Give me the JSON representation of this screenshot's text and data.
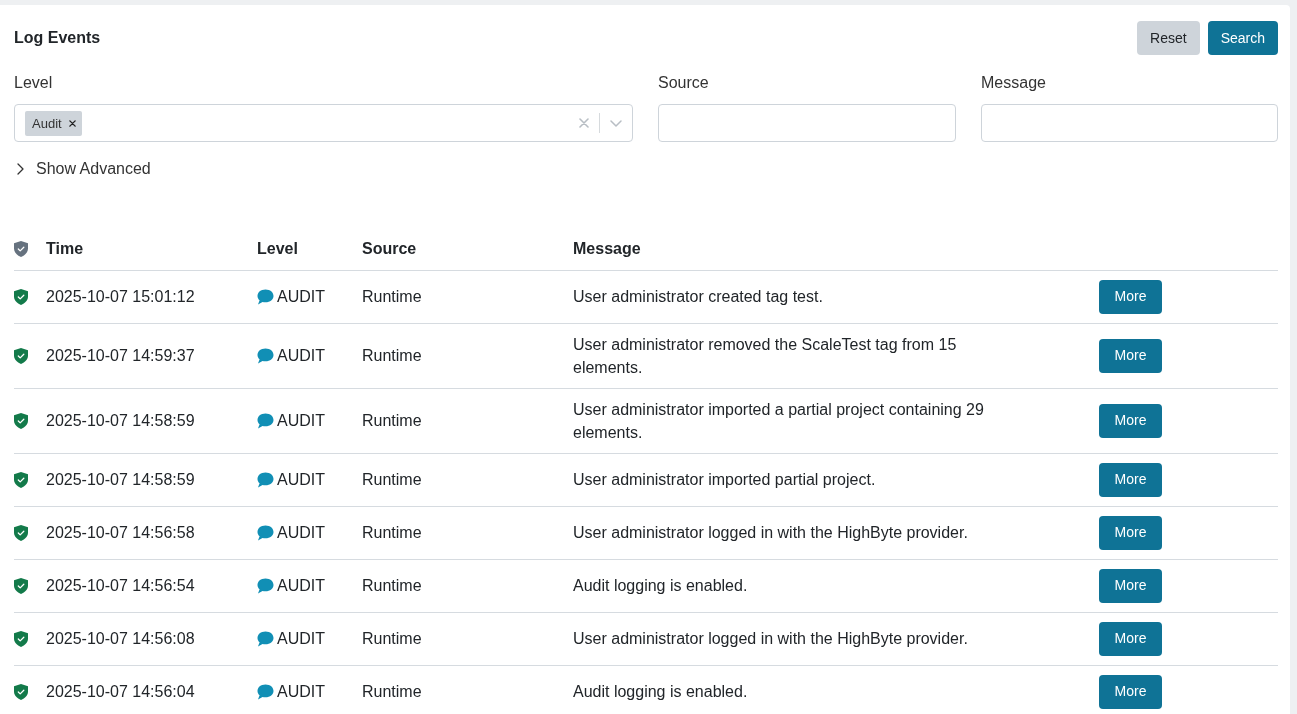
{
  "panel": {
    "title": "Log Events",
    "buttons": [
      {
        "label": "Reset",
        "kind": "secondary"
      },
      {
        "label": "Search",
        "kind": "primary"
      }
    ]
  },
  "filters": [
    {
      "kind": "multiselect",
      "label": "Level",
      "chips": [
        "Audit"
      ]
    },
    {
      "kind": "text",
      "label": "Source"
    },
    {
      "kind": "text",
      "label": "Message"
    }
  ],
  "advanced": {
    "label": "Show Advanced",
    "expanded": false
  },
  "table": {
    "columns": [
      "Time",
      "Level",
      "Source",
      "Message"
    ],
    "rows": [
      {
        "time": "2025-10-07 15:01:12",
        "level": "AUDIT",
        "source": "Runtime",
        "message": "User administrator created tag test.",
        "action": "More"
      },
      {
        "time": "2025-10-07 14:59:37",
        "level": "AUDIT",
        "source": "Runtime",
        "message": "User administrator removed the ScaleTest tag from 15 elements.",
        "action": "More"
      },
      {
        "time": "2025-10-07 14:58:59",
        "level": "AUDIT",
        "source": "Runtime",
        "message": "User administrator imported a partial project containing 29 elements.",
        "action": "More"
      },
      {
        "time": "2025-10-07 14:58:59",
        "level": "AUDIT",
        "source": "Runtime",
        "message": "User administrator imported partial project.",
        "action": "More"
      },
      {
        "time": "2025-10-07 14:56:58",
        "level": "AUDIT",
        "source": "Runtime",
        "message": "User administrator logged in with the HighByte provider.",
        "action": "More"
      },
      {
        "time": "2025-10-07 14:56:54",
        "level": "AUDIT",
        "source": "Runtime",
        "message": "Audit logging is enabled.",
        "action": "More"
      },
      {
        "time": "2025-10-07 14:56:08",
        "level": "AUDIT",
        "source": "Runtime",
        "message": "User administrator logged in with the HighByte provider.",
        "action": "More"
      },
      {
        "time": "2025-10-07 14:56:04",
        "level": "AUDIT",
        "source": "Runtime",
        "message": "Audit logging is enabled.",
        "action": "More"
      }
    ]
  }
}
